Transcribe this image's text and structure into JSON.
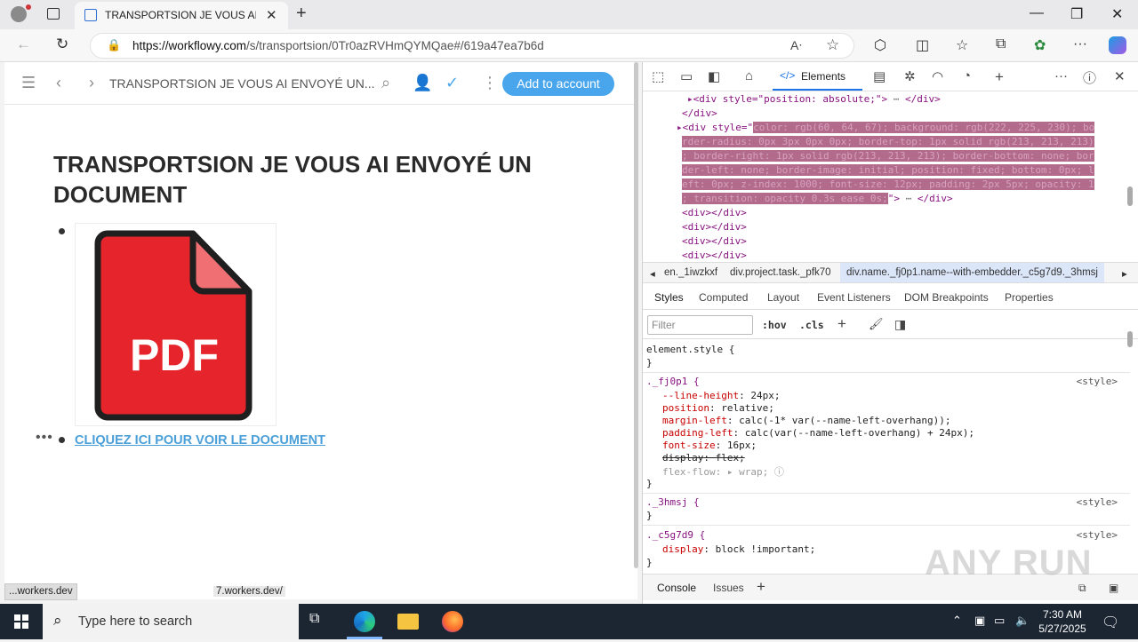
{
  "browser": {
    "tab_title": "TRANSPORTSION JE VOUS AI ENVOYÉ UN DOCUMENT",
    "url_host": "https://workflowy.com",
    "url_path": "/s/transportsion/0Tr0azRVHmQYMQae#/619a47ea7b6d",
    "status_text_1": "...workers.dev",
    "status_text_2": "7.workers.dev/"
  },
  "workflowy": {
    "breadcrumb": "TRANSPORTSION JE VOUS AI ENVOYÉ UN...",
    "add_account": "Add to account",
    "title": "TRANSPORTSION JE VOUS AI ENVOYÉ UN DOCUMENT",
    "pdf_label": "PDF",
    "link_text": "CLIQUEZ ICI POUR VOIR LE DOCUMENT"
  },
  "devtools": {
    "elements_tab": "Elements",
    "dom_lines": [
      "<div style=\"position: absolute;\">",
      "</div>",
      "<div style=\"",
      "color: rgb(60, 64, 67); background: rgb(222, 225, 230); bo",
      "rder-radius: 0px 3px 0px 0px; border-top: 1px solid rgb(213, 213, 213)",
      "; border-right: 1px solid rgb(213, 213, 213); border-bottom: none; bor",
      "der-left: none; border-image: initial; position: fixed; bottom: 0px; l",
      "eft: 0px; z-index: 1000; font-size: 12px; padding: 2px 5px; opacity: 1",
      "; transition: opacity 0.3s ease 0s;",
      "<div></div>",
      "<div></div>",
      "<div></div>",
      "<div></div>"
    ],
    "crumbs": [
      "en._1iwzkxf",
      "div.project.task._pfk70",
      "div.name._fj0p1.name--with-embedder._c5g7d9._3hmsj"
    ],
    "subtabs": [
      "Styles",
      "Computed",
      "Layout",
      "Event Listeners",
      "DOM Breakpoints",
      "Properties"
    ],
    "filter_placeholder": "Filter",
    "hov": ":hov",
    "cls": ".cls",
    "styles": {
      "element_style": "element.style {",
      "close": "}",
      "rule1_selector": "._fj0p1 {",
      "rule1_source": "<style>",
      "rule1_props": [
        [
          "--line-height",
          "24px;"
        ],
        [
          "position",
          "relative;"
        ],
        [
          "margin-left",
          "calc(-1* var(--name-left-overhang));"
        ],
        [
          "padding-left",
          "calc(var(--name-left-overhang) + 24px);"
        ],
        [
          "font-size",
          "16px;"
        ],
        [
          "display",
          "flex;"
        ],
        [
          "flex-flow",
          "▸ wrap;"
        ]
      ],
      "rule2_selector": "._3hmsj {",
      "rule2_source": "<style>",
      "rule3_selector": "._c5g7d9 {",
      "rule3_source": "<style>",
      "rule3_prop": "display",
      "rule3_val": "block !important;"
    },
    "console": "Console",
    "issues": "Issues"
  },
  "watermark": "ANY RUN",
  "taskbar": {
    "search_placeholder": "Type here to search",
    "time": "7:30 AM",
    "date": "5/27/2025"
  }
}
